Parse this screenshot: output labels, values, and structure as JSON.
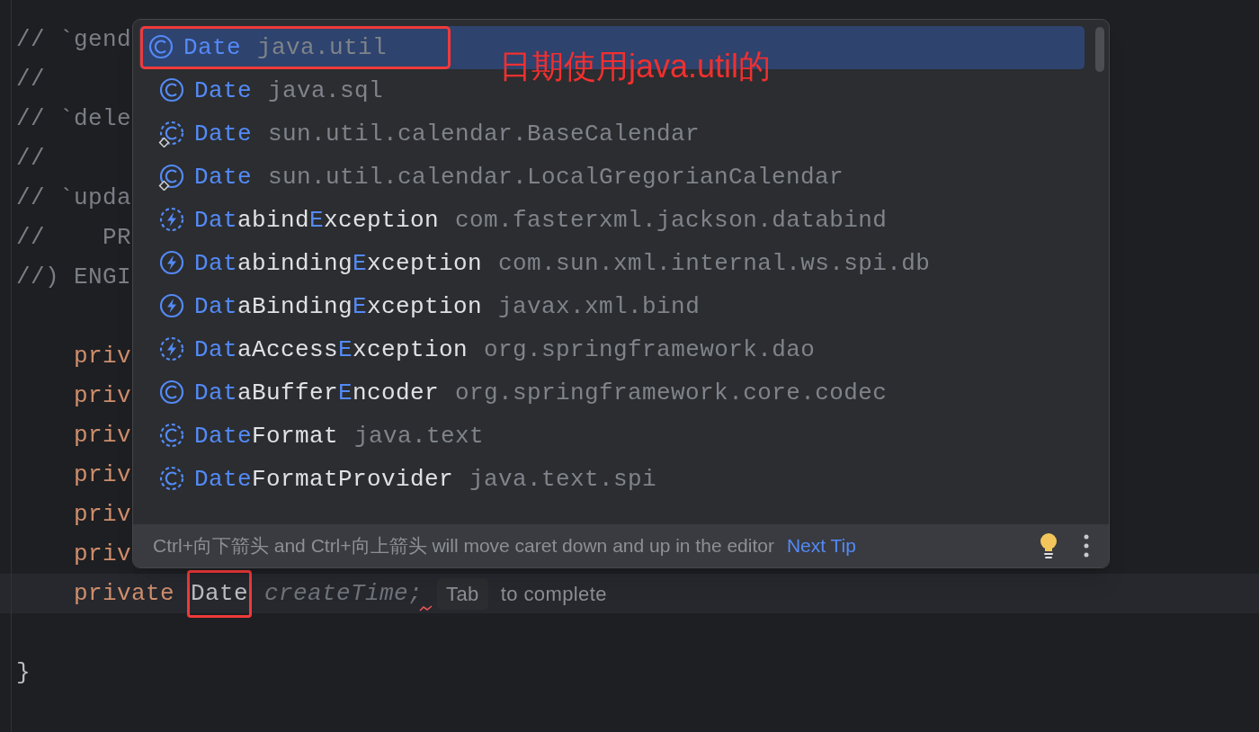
{
  "editor": {
    "lines": [
      {
        "kind": "code",
        "segments": [
          {
            "text": "// `gend",
            "kind": "comment"
          }
        ]
      },
      {
        "kind": "code",
        "segments": [
          {
            "text": "//",
            "kind": "comment"
          }
        ]
      },
      {
        "kind": "code",
        "segments": [
          {
            "text": "// `dele",
            "kind": "comment"
          }
        ]
      },
      {
        "kind": "code",
        "segments": [
          {
            "text": "//",
            "kind": "comment"
          }
        ]
      },
      {
        "kind": "code",
        "segments": [
          {
            "text": "// `upda",
            "kind": "comment"
          }
        ]
      },
      {
        "kind": "code",
        "segments": [
          {
            "text": "//    PR",
            "kind": "comment"
          }
        ]
      },
      {
        "kind": "code",
        "segments": [
          {
            "text": "//) ENGI",
            "kind": "comment"
          }
        ]
      },
      {
        "kind": "blank"
      },
      {
        "kind": "code",
        "segments": [
          {
            "text": "    priv",
            "kind": "keyword"
          }
        ]
      },
      {
        "kind": "code",
        "segments": [
          {
            "text": "    priv",
            "kind": "keyword"
          }
        ]
      },
      {
        "kind": "code",
        "segments": [
          {
            "text": "    priv",
            "kind": "keyword"
          }
        ]
      },
      {
        "kind": "code",
        "segments": [
          {
            "text": "    priv",
            "kind": "keyword"
          }
        ]
      },
      {
        "kind": "code",
        "segments": [
          {
            "text": "    priv",
            "kind": "keyword"
          }
        ]
      },
      {
        "kind": "code",
        "segments": [
          {
            "text": "    priv",
            "kind": "keyword"
          }
        ]
      },
      {
        "kind": "code",
        "current": true,
        "segments": [
          {
            "text": "    private",
            "kind": "keyword"
          },
          {
            "text": "Date",
            "kind": "plain",
            "outlined": true
          },
          {
            "text": "createTime;",
            "kind": "ghost"
          }
        ],
        "hint": {
          "key": "Tab",
          "text": "to complete"
        }
      },
      {
        "kind": "blank"
      },
      {
        "kind": "code",
        "segments": [
          {
            "text": "}",
            "kind": "plain"
          }
        ]
      }
    ]
  },
  "completion": {
    "items": [
      {
        "kind": "class",
        "abstract": false,
        "restricted": false,
        "selected": true,
        "outlined": true,
        "name": [
          {
            "text": "Date",
            "match": true
          }
        ],
        "package": "java.util"
      },
      {
        "kind": "class",
        "abstract": false,
        "restricted": false,
        "selected": false,
        "outlined": false,
        "name": [
          {
            "text": "Date",
            "match": true
          }
        ],
        "package": "java.sql"
      },
      {
        "kind": "class",
        "abstract": true,
        "restricted": true,
        "selected": false,
        "outlined": false,
        "name": [
          {
            "text": "Date",
            "match": true
          }
        ],
        "package": "sun.util.calendar.BaseCalendar"
      },
      {
        "kind": "class",
        "abstract": false,
        "restricted": true,
        "selected": false,
        "outlined": false,
        "name": [
          {
            "text": "Date",
            "match": true
          }
        ],
        "package": "sun.util.calendar.LocalGregorianCalendar"
      },
      {
        "kind": "exception",
        "abstract": true,
        "restricted": false,
        "selected": false,
        "outlined": false,
        "name": [
          {
            "text": "Dat",
            "match": true
          },
          {
            "text": "abind",
            "match": false
          },
          {
            "text": "E",
            "match": true
          },
          {
            "text": "xception",
            "match": false
          }
        ],
        "package": "com.fasterxml.jackson.databind"
      },
      {
        "kind": "exception",
        "abstract": false,
        "restricted": false,
        "selected": false,
        "outlined": false,
        "name": [
          {
            "text": "Dat",
            "match": true
          },
          {
            "text": "abinding",
            "match": false
          },
          {
            "text": "E",
            "match": true
          },
          {
            "text": "xception",
            "match": false
          }
        ],
        "package": "com.sun.xml.internal.ws.spi.db"
      },
      {
        "kind": "exception",
        "abstract": false,
        "restricted": false,
        "selected": false,
        "outlined": false,
        "name": [
          {
            "text": "Dat",
            "match": true
          },
          {
            "text": "aBinding",
            "match": false
          },
          {
            "text": "E",
            "match": true
          },
          {
            "text": "xception",
            "match": false
          }
        ],
        "package": "javax.xml.bind"
      },
      {
        "kind": "exception",
        "abstract": true,
        "restricted": false,
        "selected": false,
        "outlined": false,
        "name": [
          {
            "text": "Dat",
            "match": true
          },
          {
            "text": "aAccess",
            "match": false
          },
          {
            "text": "E",
            "match": true
          },
          {
            "text": "xception",
            "match": false
          }
        ],
        "package": "org.springframework.dao"
      },
      {
        "kind": "class",
        "abstract": false,
        "restricted": false,
        "selected": false,
        "outlined": false,
        "name": [
          {
            "text": "Dat",
            "match": true
          },
          {
            "text": "aBuffer",
            "match": false
          },
          {
            "text": "E",
            "match": true
          },
          {
            "text": "ncoder",
            "match": false
          }
        ],
        "package": "org.springframework.core.codec"
      },
      {
        "kind": "class",
        "abstract": true,
        "restricted": false,
        "selected": false,
        "outlined": false,
        "name": [
          {
            "text": "Date",
            "match": true
          },
          {
            "text": "Format",
            "match": false
          }
        ],
        "package": "java.text"
      },
      {
        "kind": "class",
        "abstract": true,
        "restricted": false,
        "selected": false,
        "outlined": false,
        "name": [
          {
            "text": "Date",
            "match": true
          },
          {
            "text": "FormatProvider",
            "match": false
          }
        ],
        "package": "java.text.spi"
      }
    ],
    "footer": {
      "tip": "Ctrl+向下箭头 and Ctrl+向上箭头 will move caret down and up in the editor",
      "link": "Next Tip"
    }
  },
  "annotation": {
    "text": "日期使用java.util的"
  }
}
